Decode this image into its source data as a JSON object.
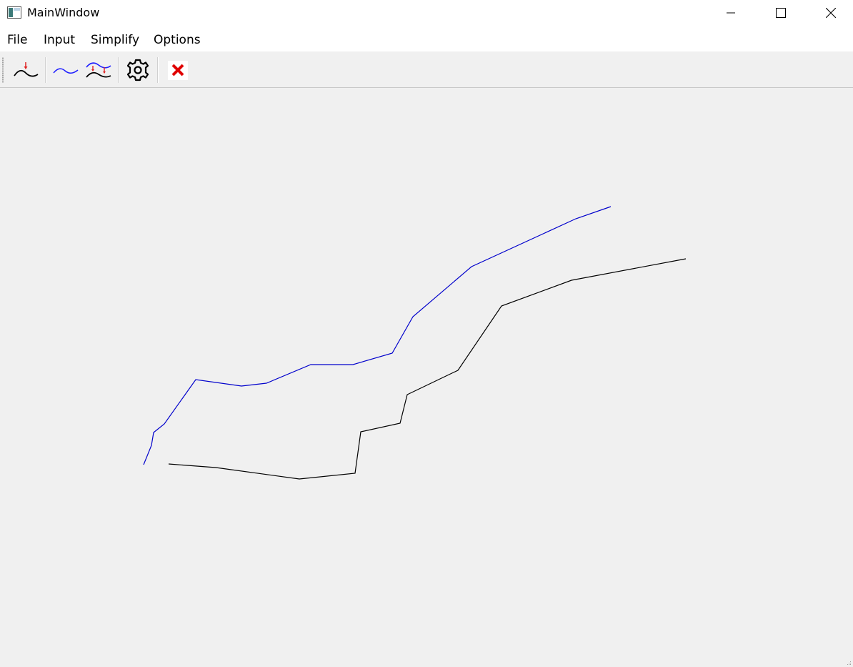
{
  "window": {
    "title": "MainWindow"
  },
  "menu": {
    "file": "File",
    "input": "Input",
    "simplify": "Simplify",
    "options": "Options"
  },
  "toolbar": {
    "icons": [
      "input-line-icon",
      "simplified-line-icon",
      "simplify-line-icon",
      "settings-gear-icon",
      "clear-icon"
    ]
  },
  "colors": {
    "original_line": "#000000",
    "simplified_line": "#0000cc",
    "clear_icon": "#e00000",
    "arrow_icon": "#e02020"
  }
}
